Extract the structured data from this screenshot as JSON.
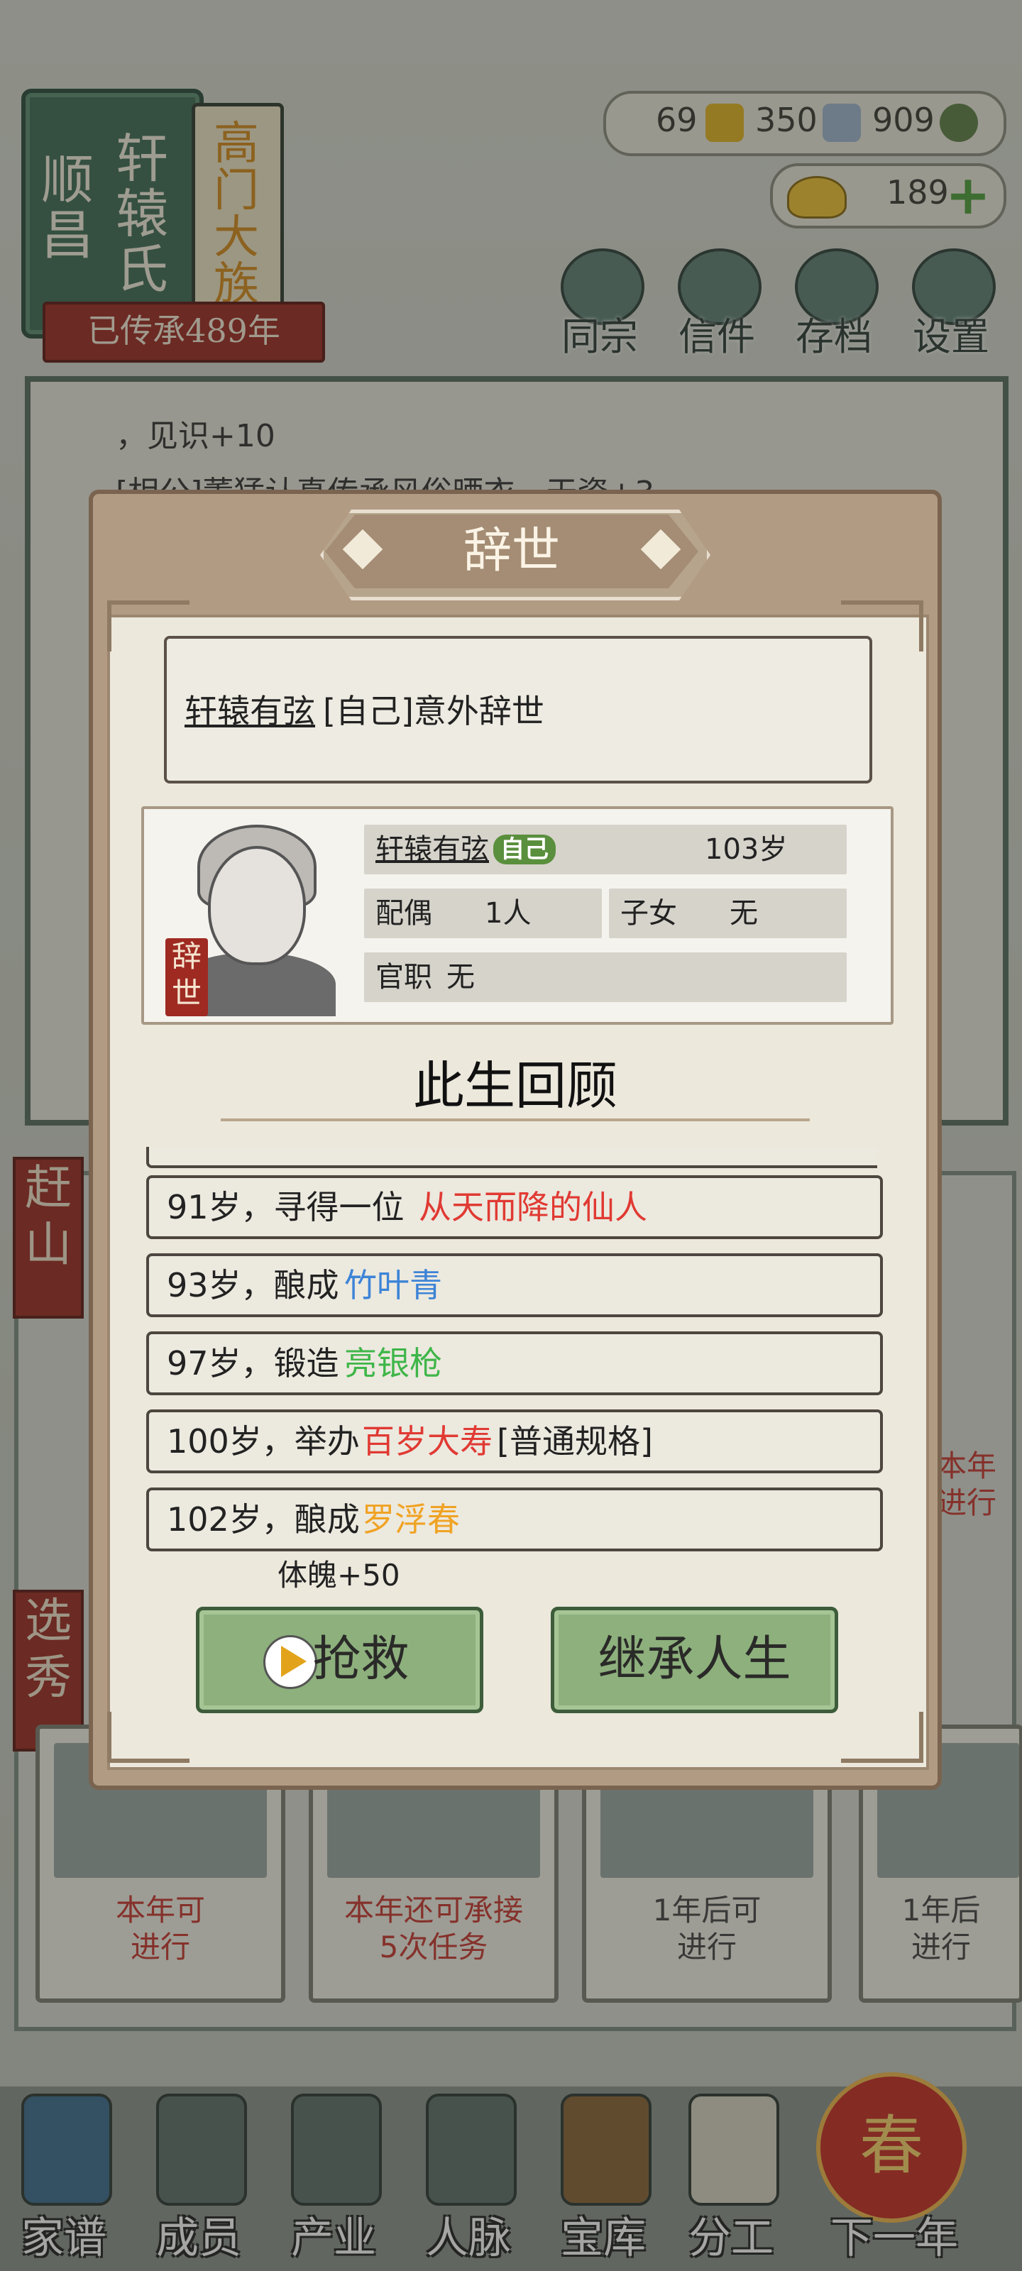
{
  "header": {
    "clan_name_line1": "顺昌",
    "clan_name_line2": "轩辕氏",
    "clan_rank": "高门大族",
    "inherit_years": "已传承489年",
    "currencies": [
      {
        "value": "69",
        "icon": "gold-bar-icon",
        "color": "#e3b323"
      },
      {
        "value": "350",
        "icon": "silver-bar-icon",
        "color": "#9fb6cf"
      },
      {
        "value": "909",
        "icon": "coin-icon",
        "color": "#5e7f45"
      }
    ],
    "gold_ingot": "189",
    "menu": [
      {
        "label": "同宗",
        "icon": "clan-book-icon"
      },
      {
        "label": "信件",
        "icon": "letter-icon"
      },
      {
        "label": "存档",
        "icon": "save-brush-icon"
      },
      {
        "label": "设置",
        "icon": "gear-icon"
      }
    ]
  },
  "log": {
    "line1": "，见识+10",
    "line2": "[相公]董猛认真传承风俗晒衣，天资+3"
  },
  "side_tags": [
    "赶山",
    "选秀"
  ],
  "tasks": [
    {
      "text": "本年可\n进行"
    },
    {
      "text": "本年还可承接\n5次任务"
    },
    {
      "text": "1年后可\n进行"
    },
    {
      "text": "1年后\n进行"
    }
  ],
  "right_partial": "本年\n进行",
  "nav": [
    {
      "label": "家谱",
      "icon": "family-tree-icon"
    },
    {
      "label": "成员",
      "icon": "member-icon"
    },
    {
      "label": "产业",
      "icon": "industry-icon"
    },
    {
      "label": "人脉",
      "icon": "network-icon"
    },
    {
      "label": "宝库",
      "icon": "treasury-icon"
    },
    {
      "label": "分工",
      "icon": "scroll-icon"
    },
    {
      "label": "下一年",
      "icon": "spring-lantern-icon",
      "badge": "春"
    }
  ],
  "dialog": {
    "title": "辞世",
    "event": {
      "name": "轩辕有弦",
      "text": "[自己]意外辞世"
    },
    "profile": {
      "seal": "辞世",
      "name": "轩辕有弦",
      "self_badge": "自己",
      "age": "103岁",
      "spouse_label": "配偶",
      "spouse_value": "1人",
      "children_label": "子女",
      "children_value": "无",
      "office_label": "官职",
      "office_value": "无"
    },
    "review_title": "此生回顾",
    "timeline": [
      {
        "prefix": "91岁，寻得一位",
        "highlight": "从天而降的仙人",
        "color": "#e03a33",
        "suffix": ""
      },
      {
        "prefix": "93岁，酿成",
        "highlight": "竹叶青",
        "color": "#3d84d6",
        "suffix": ""
      },
      {
        "prefix": "97岁，锻造",
        "highlight": "亮银枪",
        "color": "#3fb649",
        "suffix": ""
      },
      {
        "prefix": "100岁，举办",
        "highlight": "百岁大寿",
        "color": "#e03a33",
        "suffix": " [普通规格]"
      },
      {
        "prefix": "102岁，酿成",
        "highlight": "罗浮春",
        "color": "#f0a324",
        "suffix": ""
      }
    ],
    "stat_note": "体魄+50",
    "rescue_button": "抢救",
    "inherit_button": "继承人生"
  }
}
